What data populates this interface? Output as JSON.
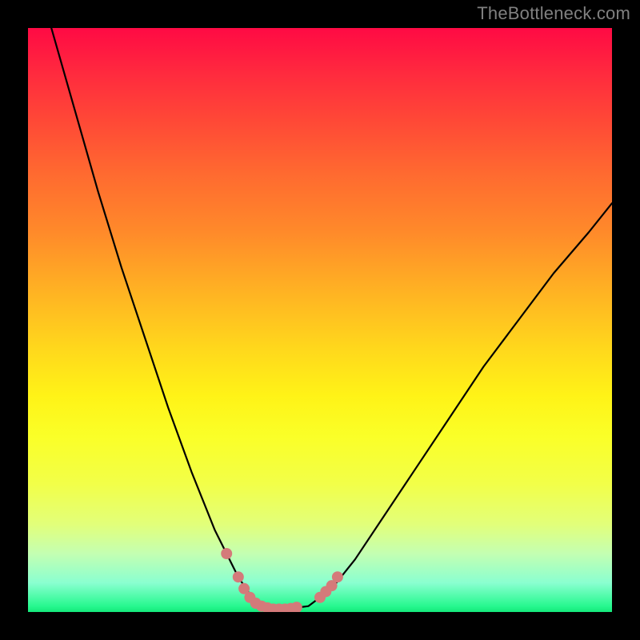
{
  "watermark": "TheBottleneck.com",
  "chart_data": {
    "type": "line",
    "title": "",
    "xlabel": "",
    "ylabel": "",
    "xlim": [
      0,
      100
    ],
    "ylim": [
      0,
      100
    ],
    "legend": false,
    "grid": false,
    "annotations": [],
    "series": [
      {
        "name": "bottleneck-curve",
        "color": "#000000",
        "x": [
          4,
          8,
          12,
          16,
          20,
          24,
          28,
          30,
          32,
          34,
          36,
          38,
          40,
          42,
          44,
          48,
          52,
          56,
          60,
          66,
          72,
          78,
          84,
          90,
          96,
          100
        ],
        "y": [
          100,
          86,
          72,
          59,
          47,
          35,
          24,
          19,
          14,
          10,
          6,
          3,
          1,
          0.5,
          0.5,
          1,
          4,
          9,
          15,
          24,
          33,
          42,
          50,
          58,
          65,
          70
        ]
      }
    ],
    "markers": {
      "name": "highlight-dots",
      "color": "#d47a7a",
      "radius": 7,
      "points": [
        {
          "x": 34,
          "y": 10
        },
        {
          "x": 36,
          "y": 6
        },
        {
          "x": 37,
          "y": 4
        },
        {
          "x": 38,
          "y": 2.5
        },
        {
          "x": 39,
          "y": 1.5
        },
        {
          "x": 40,
          "y": 1
        },
        {
          "x": 41,
          "y": 0.7
        },
        {
          "x": 42,
          "y": 0.5
        },
        {
          "x": 43,
          "y": 0.5
        },
        {
          "x": 44,
          "y": 0.5
        },
        {
          "x": 45,
          "y": 0.6
        },
        {
          "x": 46,
          "y": 0.8
        },
        {
          "x": 50,
          "y": 2.5
        },
        {
          "x": 51,
          "y": 3.5
        },
        {
          "x": 52,
          "y": 4.5
        },
        {
          "x": 53,
          "y": 6
        }
      ]
    },
    "gradient_type": "vertical-rainbow"
  }
}
